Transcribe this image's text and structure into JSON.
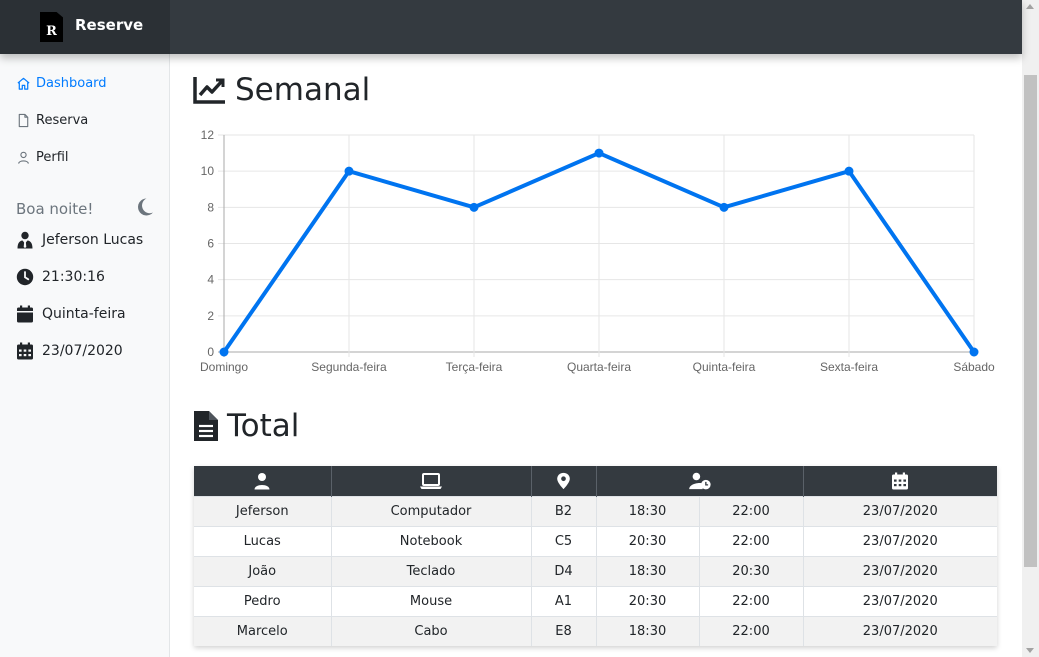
{
  "brand": {
    "logo_letter": "R",
    "name": "Reserve"
  },
  "sidebar": {
    "nav": [
      {
        "label": "Dashboard",
        "icon": "home-icon",
        "active": true
      },
      {
        "label": "Reserva",
        "icon": "file-icon",
        "active": false
      },
      {
        "label": "Perfil",
        "icon": "user-icon",
        "active": false
      }
    ],
    "greeting": "Boa noite!",
    "greeting_icon": "moon-icon",
    "user_name": "Jeferson Lucas",
    "time": "21:30:16",
    "weekday": "Quinta-feira",
    "date": "23/07/2020"
  },
  "sections": {
    "weekly_title": "Semanal",
    "total_title": "Total"
  },
  "chart_data": {
    "type": "line",
    "categories": [
      "Domingo",
      "Segunda-feira",
      "Terça-feira",
      "Quarta-feira",
      "Quinta-feira",
      "Sexta-feira",
      "Sábado"
    ],
    "values": [
      0,
      10,
      8,
      11,
      8,
      10,
      0
    ],
    "ylim": [
      0,
      12
    ],
    "yticks": [
      0,
      2,
      4,
      6,
      8,
      10,
      12
    ],
    "grid": true,
    "color": "#0074f0"
  },
  "table": {
    "header_icons": [
      "user-icon",
      "laptop-icon",
      "location-pin-icon",
      "user-clock-icon",
      "calendar-icon"
    ],
    "rows": [
      [
        "Jeferson",
        "Computador",
        "B2",
        "18:30",
        "22:00",
        "23/07/2020"
      ],
      [
        "Lucas",
        "Notebook",
        "C5",
        "20:30",
        "22:00",
        "23/07/2020"
      ],
      [
        "João",
        "Teclado",
        "D4",
        "18:30",
        "20:30",
        "23/07/2020"
      ],
      [
        "Pedro",
        "Mouse",
        "A1",
        "20:30",
        "22:00",
        "23/07/2020"
      ],
      [
        "Marcelo",
        "Cabo",
        "E8",
        "18:30",
        "22:00",
        "23/07/2020"
      ]
    ]
  },
  "colors": {
    "topbar": "#343a40",
    "accent": "#007bff",
    "sidebar_bg": "#f8f9fa"
  }
}
